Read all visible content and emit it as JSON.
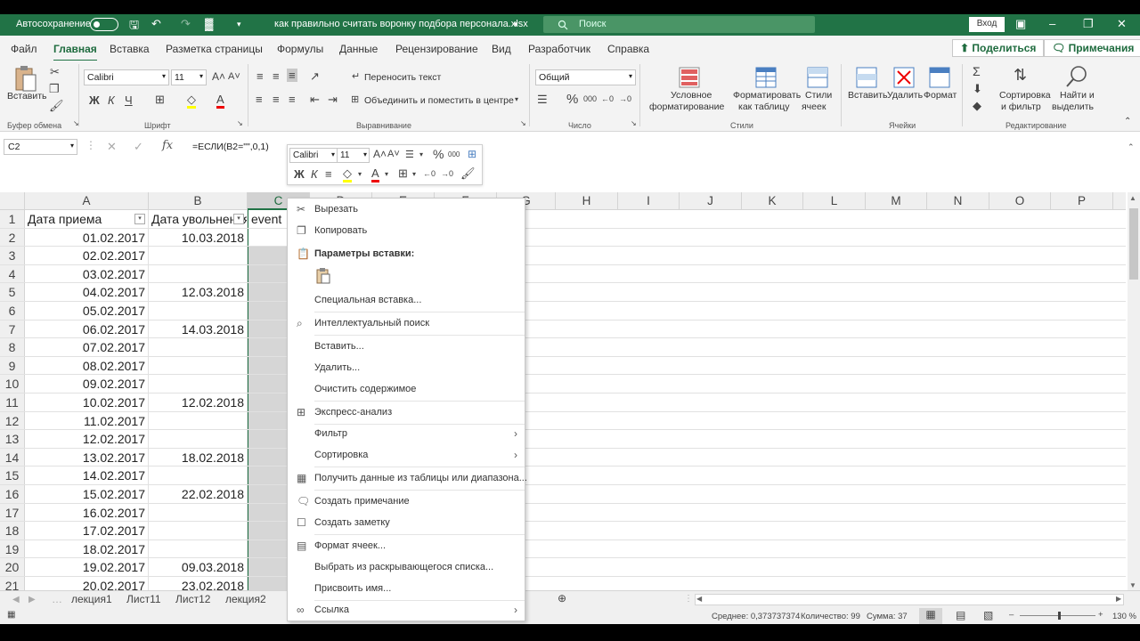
{
  "title_bar": {
    "autosave_label": "Автосохранение",
    "filename": "как правильно считать воронку подбора персонала.xlsx",
    "search_placeholder": "Поиск",
    "login_button": "Вход"
  },
  "ribbon_tabs": [
    "Файл",
    "Главная",
    "Вставка",
    "Разметка страницы",
    "Формулы",
    "Данные",
    "Рецензирование",
    "Вид",
    "Разработчик",
    "Справка"
  ],
  "active_tab": "Главная",
  "share_button": "Поделиться",
  "comments_button": "Примечания",
  "ribbon": {
    "paste_label": "Вставить",
    "clipboard_group": "Буфер обмена",
    "font_name": "Calibri",
    "font_size": "11",
    "font_group": "Шрифт",
    "wrap_text": "Переносить текст",
    "merge_center": "Объединить и поместить в центре",
    "alignment_group": "Выравнивание",
    "number_format": "Общий",
    "number_group": "Число",
    "conditional_formatting": [
      "Условное",
      "форматирование"
    ],
    "format_as_table": [
      "Форматировать",
      "как таблицу"
    ],
    "cell_styles": [
      "Стили",
      "ячеек"
    ],
    "styles_group": "Стили",
    "insert_label": "Вставить",
    "delete_label": "Удалить",
    "format_label": "Формат",
    "cells_group": "Ячейки",
    "sort_filter": [
      "Сортировка",
      "и фильтр"
    ],
    "find_select": [
      "Найти и",
      "выделить"
    ],
    "editing_group": "Редактирование"
  },
  "formula_bar": {
    "name_box": "C2",
    "formula": "=ЕСЛИ(B2=\"\",0,1)"
  },
  "mini_toolbar": {
    "font": "Calibri",
    "size": "11"
  },
  "columns": [
    "A",
    "B",
    "C",
    "D",
    "E",
    "F",
    "G",
    "H",
    "I",
    "J",
    "K",
    "L",
    "M",
    "N",
    "O",
    "P"
  ],
  "header_row": {
    "num": "1",
    "a": "Дата приема",
    "b": "Дата увольнения",
    "c": "event"
  },
  "rows": [
    {
      "num": "2",
      "a": "01.02.2017",
      "b": "10.03.2018"
    },
    {
      "num": "3",
      "a": "02.02.2017",
      "b": ""
    },
    {
      "num": "4",
      "a": "03.02.2017",
      "b": ""
    },
    {
      "num": "5",
      "a": "04.02.2017",
      "b": "12.03.2018"
    },
    {
      "num": "6",
      "a": "05.02.2017",
      "b": ""
    },
    {
      "num": "7",
      "a": "06.02.2017",
      "b": "14.03.2018"
    },
    {
      "num": "8",
      "a": "07.02.2017",
      "b": ""
    },
    {
      "num": "9",
      "a": "08.02.2017",
      "b": ""
    },
    {
      "num": "10",
      "a": "09.02.2017",
      "b": ""
    },
    {
      "num": "11",
      "a": "10.02.2017",
      "b": "12.02.2018"
    },
    {
      "num": "12",
      "a": "11.02.2017",
      "b": ""
    },
    {
      "num": "13",
      "a": "12.02.2017",
      "b": ""
    },
    {
      "num": "14",
      "a": "13.02.2017",
      "b": "18.02.2018"
    },
    {
      "num": "15",
      "a": "14.02.2017",
      "b": ""
    },
    {
      "num": "16",
      "a": "15.02.2017",
      "b": "22.02.2018"
    },
    {
      "num": "17",
      "a": "16.02.2017",
      "b": ""
    },
    {
      "num": "18",
      "a": "17.02.2017",
      "b": ""
    },
    {
      "num": "19",
      "a": "18.02.2017",
      "b": ""
    },
    {
      "num": "20",
      "a": "19.02.2017",
      "b": "09.03.2018"
    },
    {
      "num": "21",
      "a": "20.02.2017",
      "b": "23.02.2018"
    }
  ],
  "context_menu": {
    "cut": "Вырезать",
    "copy": "Копировать",
    "paste_options": "Параметры вставки:",
    "paste_special": "Специальная вставка...",
    "smart_lookup": "Интеллектуальный поиск",
    "insert": "Вставить...",
    "delete": "Удалить...",
    "clear_contents": "Очистить содержимое",
    "quick_analysis": "Экспресс-анализ",
    "filter": "Фильтр",
    "sort": "Сортировка",
    "get_data": "Получить данные из таблицы или диапазона...",
    "new_comment": "Создать примечание",
    "new_note": "Создать заметку",
    "format_cells": "Формат ячеек...",
    "pick_from_list": "Выбрать из раскрывающегося списка...",
    "define_name": "Присвоить имя...",
    "link": "Ссылка"
  },
  "sheets": [
    "лекция1",
    "Лист11",
    "Лист12",
    "лекция2"
  ],
  "status_bar": {
    "average": "Среднее: 0,373737374",
    "count": "Количество: 99",
    "sum": "Сумма: 37",
    "zoom": "130 %"
  }
}
